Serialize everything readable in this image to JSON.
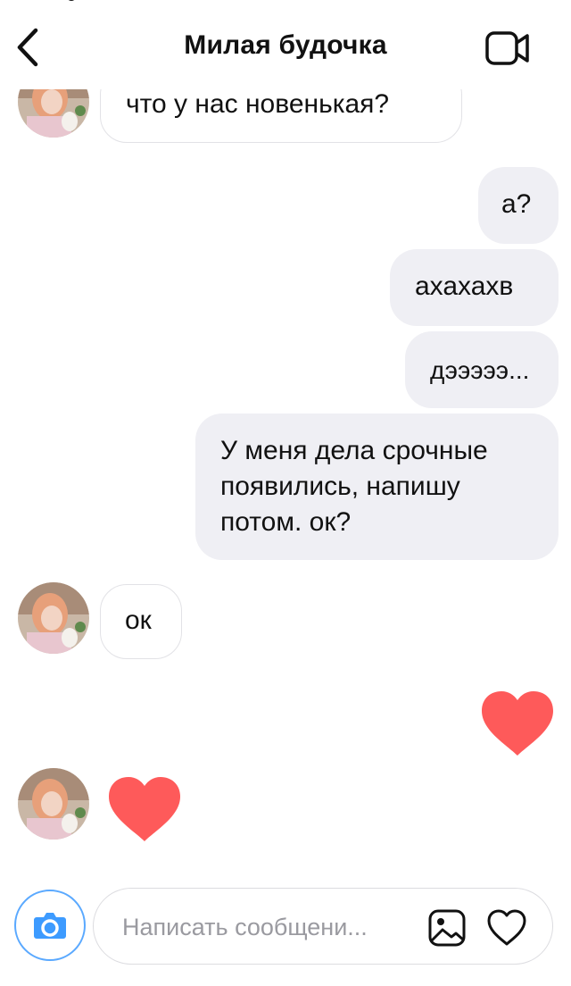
{
  "header": {
    "title": "Милая будочка"
  },
  "messages": [
    {
      "from": "them",
      "text": "что у нас новенькая?"
    },
    {
      "from": "me",
      "text": "а?"
    },
    {
      "from": "me",
      "text": "ахахахв"
    },
    {
      "from": "me",
      "text": "дэээээ..."
    },
    {
      "from": "me",
      "lines": [
        "У меня дела срочные",
        "появились, напишу",
        "потом. ок?"
      ]
    },
    {
      "from": "them",
      "text": "ок"
    },
    {
      "from": "me",
      "type": "heart"
    },
    {
      "from": "them",
      "type": "heart"
    }
  ],
  "composer": {
    "placeholder": "Написать сообщени..."
  },
  "colors": {
    "heart": "#fe5a5a",
    "camera_accent": "#3d9bff",
    "outgoing_bubble": "#efeff4",
    "incoming_border": "#e2e2e6"
  },
  "icons": {
    "back": "chevron-left-icon",
    "video": "video-camera-icon",
    "camera": "camera-icon",
    "gallery": "gallery-icon",
    "like": "heart-outline-icon"
  }
}
